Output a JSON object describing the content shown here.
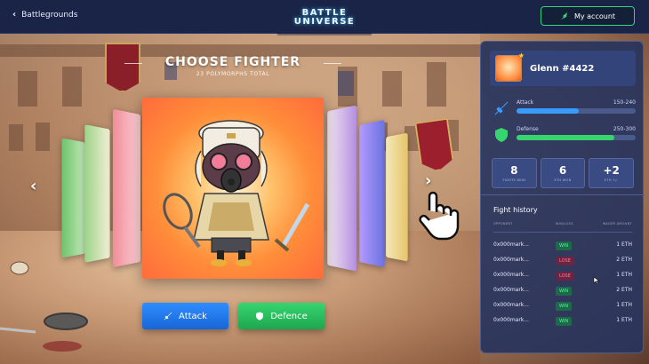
{
  "header": {
    "back_label": "Battlegrounds",
    "logo_line1": "BATTLE",
    "logo_line2": "UNIVERSE",
    "account_label": "My account"
  },
  "arena": {
    "title": "CHOOSE FIGHTER",
    "subtitle": "23 POLYMORPHS TOTAL"
  },
  "actions": {
    "attack_label": "Attack",
    "defence_label": "Defence"
  },
  "profile": {
    "name": "Glenn #4422"
  },
  "stats": [
    {
      "label": "Attack",
      "range": "150-240",
      "fill": 0.52,
      "color": "#3a9bff"
    },
    {
      "label": "Defense",
      "range": "250-300",
      "fill": 0.82,
      "color": "#36d56f"
    }
  ],
  "counters": [
    {
      "value": "8",
      "label": "FIGHTS WON"
    },
    {
      "value": "6",
      "label": "ETH WON"
    },
    {
      "value": "+2",
      "label": "ETH +/-"
    }
  ],
  "fight_history": {
    "title": "Fight history",
    "columns": [
      "OPPONENT",
      "WIN/LOSS",
      "WAGER AMOUNT"
    ],
    "rows": [
      {
        "opponent": "0x000mark...",
        "result": "WIN",
        "amount": "1 ETH"
      },
      {
        "opponent": "0x000mark...",
        "result": "LOSE",
        "amount": "2 ETH"
      },
      {
        "opponent": "0x000mark...",
        "result": "LOSE",
        "amount": "1 ETH"
      },
      {
        "opponent": "0x000mark...",
        "result": "WIN",
        "amount": "2 ETH"
      },
      {
        "opponent": "0x000mark...",
        "result": "WIN",
        "amount": "1 ETH"
      },
      {
        "opponent": "0x000mark...",
        "result": "WIN",
        "amount": "1 ETH"
      }
    ]
  },
  "colors": {
    "topbar": "#1a2447",
    "panel": "#28345c",
    "accent_green": "#36d56f",
    "accent_blue": "#2f8dff"
  }
}
